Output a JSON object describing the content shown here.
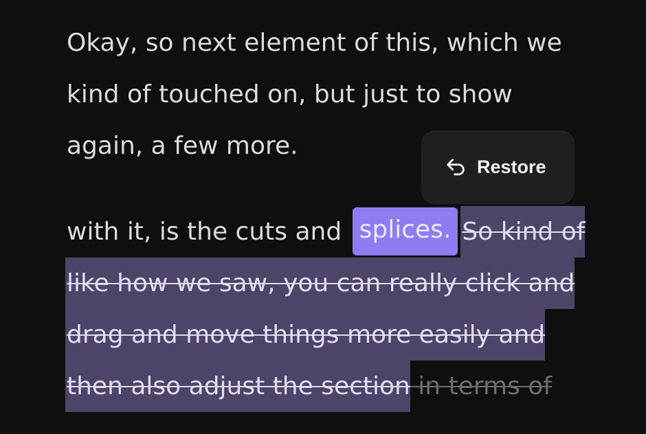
{
  "paragraph1": {
    "lines": [
      "Okay, so next element of this, which we",
      "kind of touched on, but just to show",
      "again, a few more."
    ]
  },
  "restore_button": {
    "label": "Restore",
    "icon": "undo-icon"
  },
  "paragraph2": {
    "line1_plain": "with it, is the cuts and ",
    "selected_word": "splices.",
    "line1_struck": "So kind of",
    "line2_struck": "like how we saw, you can really click and",
    "line3_struck": "drag and move things more easily and",
    "line4_struck": "then also adjust the section",
    "line4_dim": " in terms of"
  },
  "colors": {
    "background": "#0f0f0f",
    "text": "#dcdcdc",
    "selection_highlight": "#8f7cf2",
    "deleted_highlight": "#4e4468"
  }
}
